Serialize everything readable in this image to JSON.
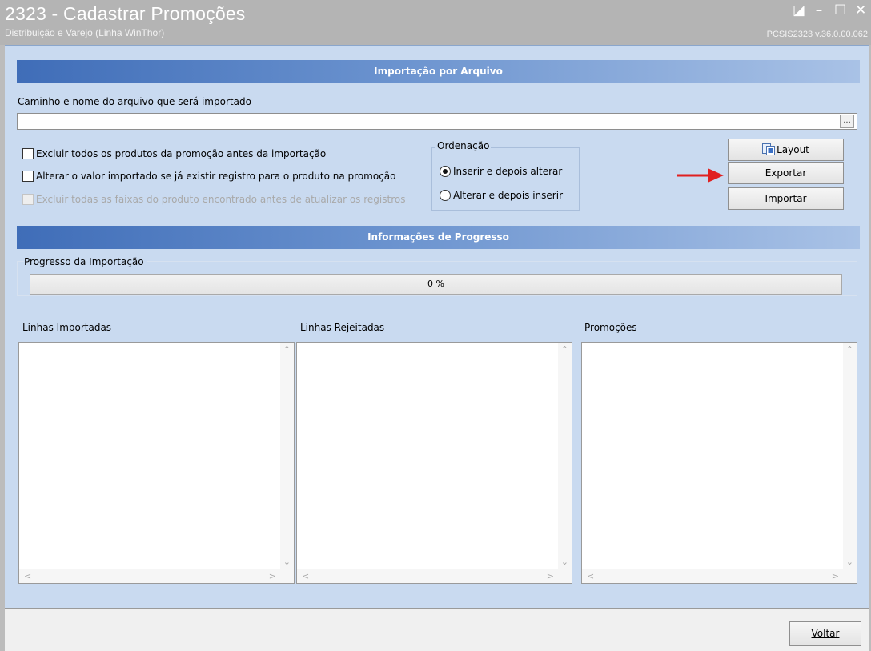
{
  "window": {
    "title": "2323 - Cadastrar Promoções",
    "subtitle": "Distribuição e Varejo (Linha WinThor)",
    "version": "PCSIS2323  v.36.0.00.062",
    "controls": {
      "restore": "◪",
      "minimize": "–",
      "maximize": "☐",
      "close": "✕"
    }
  },
  "import_section": {
    "header": "Importação por Arquivo",
    "path_label": "Caminho e nome do arquivo que será importado",
    "path_value": "",
    "browse_label": "...",
    "options": [
      {
        "label": "Excluir todos os produtos da promoção antes da importação",
        "checked": false,
        "enabled": true
      },
      {
        "label": "Alterar o valor importado se já existir registro para o produto na promoção",
        "checked": false,
        "enabled": true
      },
      {
        "label": "Excluir todas as faixas do produto encontrado antes de atualizar os registros",
        "checked": false,
        "enabled": false
      }
    ],
    "ordenacao": {
      "legend": "Ordenação",
      "options": [
        {
          "label": "Inserir e depois alterar",
          "selected": true
        },
        {
          "label": "Alterar e depois inserir",
          "selected": false
        }
      ]
    },
    "buttons": {
      "layout": "Layout",
      "exportar": "Exportar",
      "importar": "Importar"
    }
  },
  "progress_section": {
    "header": "Informações de Progresso",
    "group_label": "Progresso da Importação",
    "progress_text": "0 %",
    "progress_value": 0
  },
  "lists": {
    "imported": "Linhas Importadas",
    "rejected": "Linhas Rejeitadas",
    "promotions": "Promoções"
  },
  "footer": {
    "voltar": "Voltar"
  },
  "colors": {
    "accent": "#3f6db8",
    "client_bg": "#c9daf0",
    "titlebar": "#b4b4b4",
    "arrow": "#e02020"
  }
}
